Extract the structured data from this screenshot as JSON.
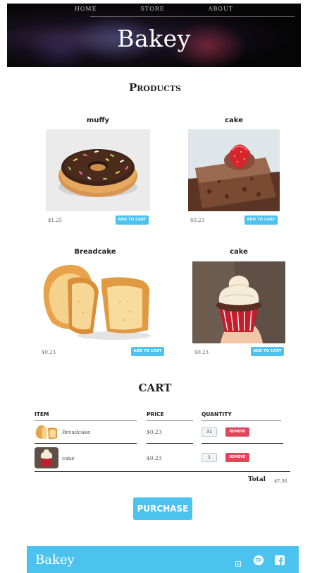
{
  "nav": {
    "home": "HOME",
    "store": "STORE",
    "about": "ABOUT"
  },
  "header": {
    "brand": "Bakey"
  },
  "products": {
    "title": "Products",
    "items": [
      {
        "name": "muffy",
        "price": "$1.25",
        "button": "ADD TO CART",
        "image": "donut"
      },
      {
        "name": "cake",
        "price": "$0.23",
        "button": "ADD TO CART",
        "image": "strawberry-brownie"
      },
      {
        "name": "Breadcake",
        "price": "$0.23",
        "button": "ADD TO CART",
        "image": "sliced-bread"
      },
      {
        "name": "cake",
        "price": "$0.23",
        "button": "ADD TO CART",
        "image": "cupcake"
      }
    ]
  },
  "cart": {
    "title": "CART",
    "headers": {
      "item": "ITEM",
      "price": "PRICE",
      "quantity": "QUANTITY"
    },
    "rows": [
      {
        "name": "Breadcake",
        "price": "$0.23",
        "quantity": "31",
        "remove": "REMOVE"
      },
      {
        "name": "cake",
        "price": "$0.23",
        "quantity": "1",
        "remove": "REMOVE"
      }
    ],
    "total_label": "Total",
    "total_value": "$7.36"
  },
  "purchase": {
    "label": "PURCHASE"
  },
  "footer": {
    "brand": "Bakey"
  },
  "colors": {
    "accent": "#4bc3ee",
    "danger": "#e0455a"
  }
}
